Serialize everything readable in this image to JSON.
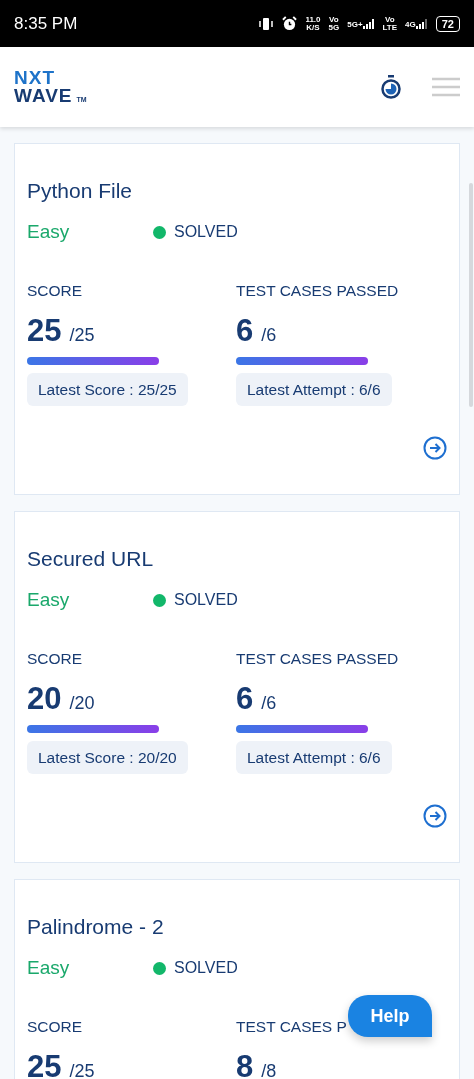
{
  "status_bar": {
    "time": "8:35 PM",
    "speed": "11.0",
    "speed_unit": "K/S",
    "net1_top": "Vo",
    "net1_bottom": "5G",
    "net2": "5G+",
    "net3_top": "Vo",
    "net3_bottom": "LTE",
    "net4": "4G",
    "battery": "72"
  },
  "header": {
    "logo_top": "NXT",
    "logo_bottom": "WAVE",
    "logo_mark": "TM"
  },
  "cards": [
    {
      "title": "Python File",
      "difficulty": "Easy",
      "status": "SOLVED",
      "score_label": "SCORE",
      "score": "25",
      "score_max": "/25",
      "score_bar": {
        "level": 1
      },
      "latest_score": "Latest Score : 25/25",
      "tests_label": "TEST CASES PASSED",
      "tests": "6",
      "tests_max": "/6",
      "tests_bar": {
        "level": 1
      },
      "latest_attempt": "Latest Attempt : 6/6"
    },
    {
      "title": "Secured URL",
      "difficulty": "Easy",
      "status": "SOLVED",
      "score_label": "SCORE",
      "score": "20",
      "score_max": "/20",
      "score_bar": {
        "level": 1
      },
      "latest_score": "Latest Score : 20/20",
      "tests_label": "TEST CASES PASSED",
      "tests": "6",
      "tests_max": "/6",
      "tests_bar": {
        "level": 1
      },
      "latest_attempt": "Latest Attempt : 6/6"
    },
    {
      "title": "Palindrome - 2",
      "difficulty": "Easy",
      "status": "SOLVED",
      "score_label": "SCORE",
      "score": "25",
      "score_max": "/25",
      "tests_label": "TEST CASES P",
      "tests": "8",
      "tests_max": "/8"
    }
  ],
  "help_button": "Help"
}
